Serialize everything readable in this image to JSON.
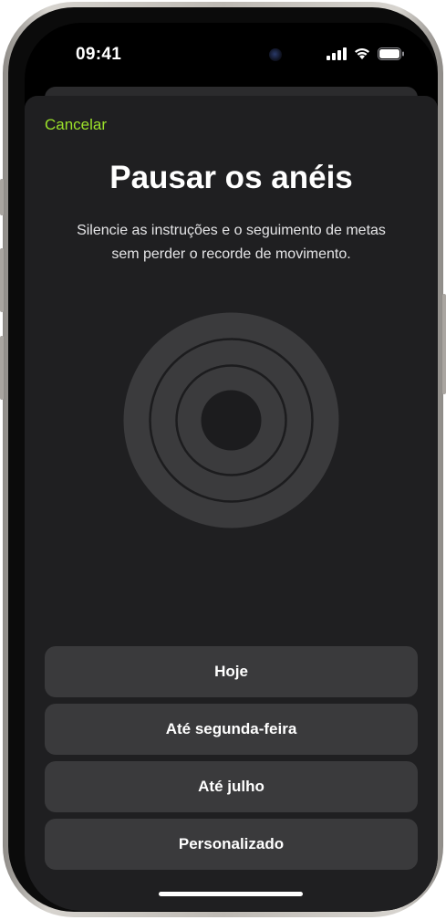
{
  "status_bar": {
    "time": "09:41"
  },
  "sheet": {
    "cancel_label": "Cancelar",
    "title": "Pausar os anéis",
    "subtitle": "Silencie as instruções e o seguimento de metas sem perder o recorde de movimento."
  },
  "options": [
    {
      "label": "Hoje"
    },
    {
      "label": "Até segunda-feira"
    },
    {
      "label": "Até julho"
    },
    {
      "label": "Personalizado"
    }
  ],
  "colors": {
    "accent": "#9be12a",
    "sheet_bg": "#1f1f21",
    "button_bg": "#3a3a3c",
    "ring_fill": "#3b3b3d"
  },
  "icons": {
    "signal": "cellular-signal-icon",
    "wifi": "wifi-icon",
    "battery": "battery-icon",
    "rings": "activity-rings-icon"
  }
}
